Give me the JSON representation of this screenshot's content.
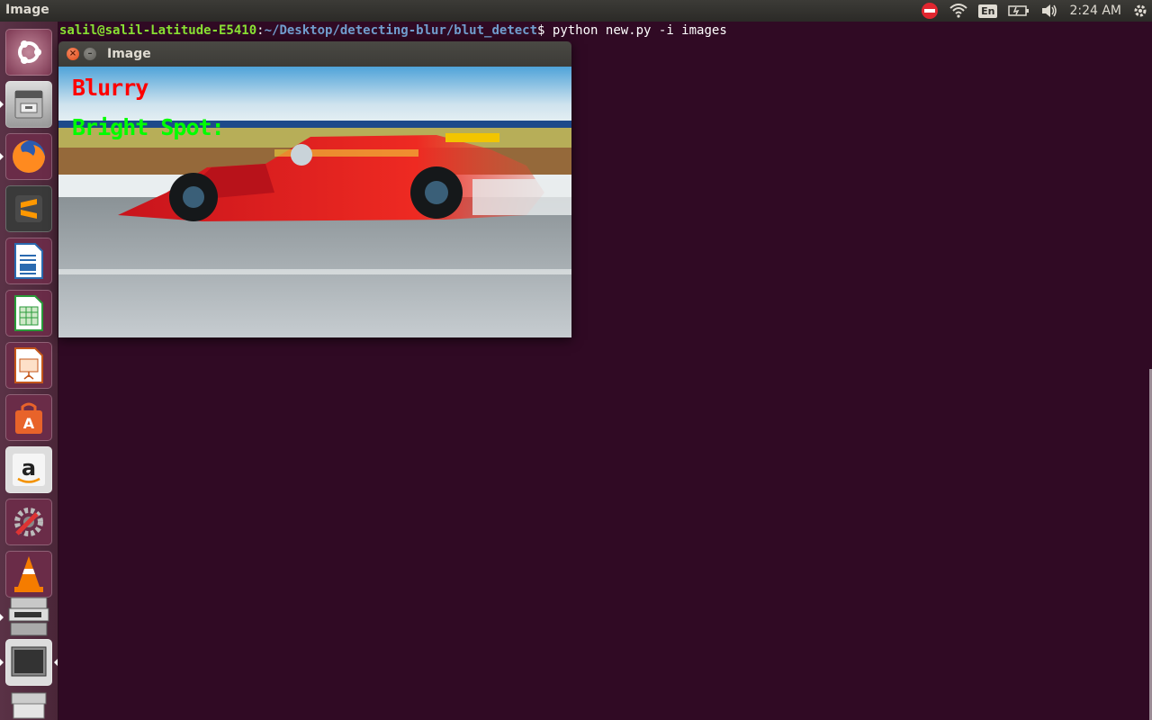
{
  "topbar": {
    "app_title": "Image",
    "clock": "2:24 AM",
    "keyboard_layout": "En",
    "icons": [
      "network-disconnected-icon",
      "wifi-icon",
      "keyboard-layout-icon",
      "battery-icon",
      "volume-icon",
      "gear-icon"
    ]
  },
  "launcher": {
    "items": [
      "ubuntu-dash",
      "files",
      "firefox",
      "sublime-text",
      "libreoffice-writer",
      "libreoffice-calc",
      "libreoffice-impress",
      "ubuntu-software",
      "amazon",
      "system-settings",
      "vlc",
      "image-viewer-stack",
      "terminal",
      "trash"
    ]
  },
  "terminal": {
    "user_host": "salil@salil-Latitude-E5410",
    "separator": ":",
    "path": "~/Desktop/detecting-blur/blut_detect",
    "prompt": "$ ",
    "command": "python new.py -i images"
  },
  "image_window": {
    "title": "Image",
    "label_blurry": "Blurry",
    "label_bright": "Bright Spot:",
    "colors": {
      "blurry": "#ff0000",
      "bright": "#00ff00"
    }
  }
}
